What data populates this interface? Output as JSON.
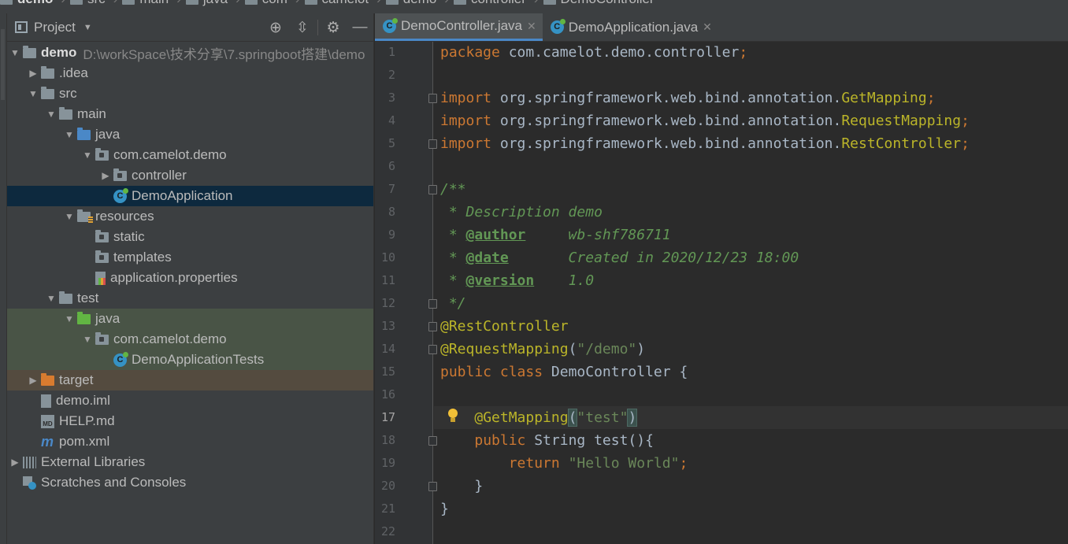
{
  "breadcrumb": [
    "demo",
    "src",
    "main",
    "java",
    "com",
    "camelot",
    "demo",
    "controller",
    "DemoController"
  ],
  "project_panel": {
    "title": "Project",
    "tools": [
      "locate-icon",
      "collapse-icon",
      "gear-icon",
      "minimize-icon"
    ],
    "tree": [
      {
        "label": "demo",
        "path": "D:\\workSpace\\技术分享\\7.springboot搭建\\demo",
        "depth": 0,
        "arrow": "open",
        "icon": "folder",
        "bold": true
      },
      {
        "label": ".idea",
        "depth": 1,
        "arrow": "closed",
        "icon": "folder"
      },
      {
        "label": "src",
        "depth": 1,
        "arrow": "open",
        "icon": "folder"
      },
      {
        "label": "main",
        "depth": 2,
        "arrow": "open",
        "icon": "folder"
      },
      {
        "label": "java",
        "depth": 3,
        "arrow": "open",
        "icon": "folder-blue"
      },
      {
        "label": "com.camelot.demo",
        "depth": 4,
        "arrow": "open",
        "icon": "package"
      },
      {
        "label": "controller",
        "depth": 5,
        "arrow": "closed",
        "icon": "package"
      },
      {
        "label": "DemoApplication",
        "depth": 5,
        "arrow": "none",
        "icon": "spring-class",
        "selected": true
      },
      {
        "label": "resources",
        "depth": 3,
        "arrow": "open",
        "icon": "resources-folder"
      },
      {
        "label": "static",
        "depth": 4,
        "arrow": "none",
        "icon": "package"
      },
      {
        "label": "templates",
        "depth": 4,
        "arrow": "none",
        "icon": "package"
      },
      {
        "label": "application.properties",
        "depth": 4,
        "arrow": "none",
        "icon": "properties-file"
      },
      {
        "label": "test",
        "depth": 2,
        "arrow": "open",
        "icon": "folder"
      },
      {
        "label": "java",
        "depth": 3,
        "arrow": "open",
        "icon": "folder-green",
        "test": true
      },
      {
        "label": "com.camelot.demo",
        "depth": 4,
        "arrow": "open",
        "icon": "package",
        "test": true
      },
      {
        "label": "DemoApplicationTests",
        "depth": 5,
        "arrow": "none",
        "icon": "spring-class",
        "test": true
      },
      {
        "label": "target",
        "depth": 1,
        "arrow": "closed",
        "icon": "folder-orange",
        "excluded": true
      },
      {
        "label": "demo.iml",
        "depth": 1,
        "arrow": "none",
        "icon": "iml-file"
      },
      {
        "label": "HELP.md",
        "depth": 1,
        "arrow": "none",
        "icon": "md-file"
      },
      {
        "label": "pom.xml",
        "depth": 1,
        "arrow": "none",
        "icon": "maven-file"
      },
      {
        "label": "External Libraries",
        "depth": 0,
        "arrow": "closed",
        "icon": "libraries"
      },
      {
        "label": "Scratches and Consoles",
        "depth": 0,
        "arrow": "none",
        "icon": "scratches"
      }
    ]
  },
  "tabs": [
    {
      "label": "DemoController.java",
      "active": true
    },
    {
      "label": "DemoApplication.java",
      "active": false
    }
  ],
  "editor": {
    "current_line": 17,
    "lines": [
      [
        {
          "t": "package ",
          "c": "kw"
        },
        {
          "t": "com.camelot.demo.controller"
        },
        {
          "t": ";",
          "c": "kw"
        }
      ],
      [],
      [
        {
          "t": "import ",
          "c": "kw"
        },
        {
          "t": "org.springframework.web.bind.annotation."
        },
        {
          "t": "GetMapping",
          "c": "an"
        },
        {
          "t": ";",
          "c": "kw"
        }
      ],
      [
        {
          "t": "import ",
          "c": "kw"
        },
        {
          "t": "org.springframework.web.bind.annotation."
        },
        {
          "t": "RequestMapping",
          "c": "an"
        },
        {
          "t": ";",
          "c": "kw"
        }
      ],
      [
        {
          "t": "import ",
          "c": "kw"
        },
        {
          "t": "org.springframework.web.bind.annotation."
        },
        {
          "t": "RestController",
          "c": "an"
        },
        {
          "t": ";",
          "c": "kw"
        }
      ],
      [],
      [
        {
          "t": "/**",
          "c": "cmt"
        }
      ],
      [
        {
          "t": " * Description demo",
          "c": "cmt"
        }
      ],
      [
        {
          "t": " * ",
          "c": "cmt"
        },
        {
          "t": "@author",
          "c": "tag"
        },
        {
          "t": "     wb-shf786711",
          "c": "cmt"
        }
      ],
      [
        {
          "t": " * ",
          "c": "cmt"
        },
        {
          "t": "@date",
          "c": "tag"
        },
        {
          "t": "       Created in 2020/12/23 18:00",
          "c": "cmt"
        }
      ],
      [
        {
          "t": " * ",
          "c": "cmt"
        },
        {
          "t": "@version",
          "c": "tag"
        },
        {
          "t": "    1.0",
          "c": "cmt"
        }
      ],
      [
        {
          "t": " */",
          "c": "cmt"
        }
      ],
      [
        {
          "t": "@RestController",
          "c": "an"
        }
      ],
      [
        {
          "t": "@RequestMapping",
          "c": "an"
        },
        {
          "t": "("
        },
        {
          "t": "\"/demo\"",
          "c": "str"
        },
        {
          "t": ")"
        }
      ],
      [
        {
          "t": "public class ",
          "c": "kw"
        },
        {
          "t": "DemoController {"
        }
      ],
      [],
      [
        {
          "t": "    "
        },
        {
          "t": "@GetMapping",
          "c": "an"
        },
        {
          "t": "(",
          "c": "bracket"
        },
        {
          "t": "\"test\"",
          "c": "str"
        },
        {
          "t": ")",
          "c": "bracket"
        }
      ],
      [
        {
          "t": "    "
        },
        {
          "t": "public ",
          "c": "kw"
        },
        {
          "t": "String test(){"
        }
      ],
      [
        {
          "t": "        "
        },
        {
          "t": "return ",
          "c": "kw"
        },
        {
          "t": "\"Hello World\"",
          "c": "str"
        },
        {
          "t": ";",
          "c": "kw"
        }
      ],
      [
        {
          "t": "    }"
        }
      ],
      [
        {
          "t": "}"
        }
      ],
      []
    ],
    "fold_lines": [
      3,
      5,
      7,
      12,
      13,
      14,
      18,
      20
    ]
  }
}
